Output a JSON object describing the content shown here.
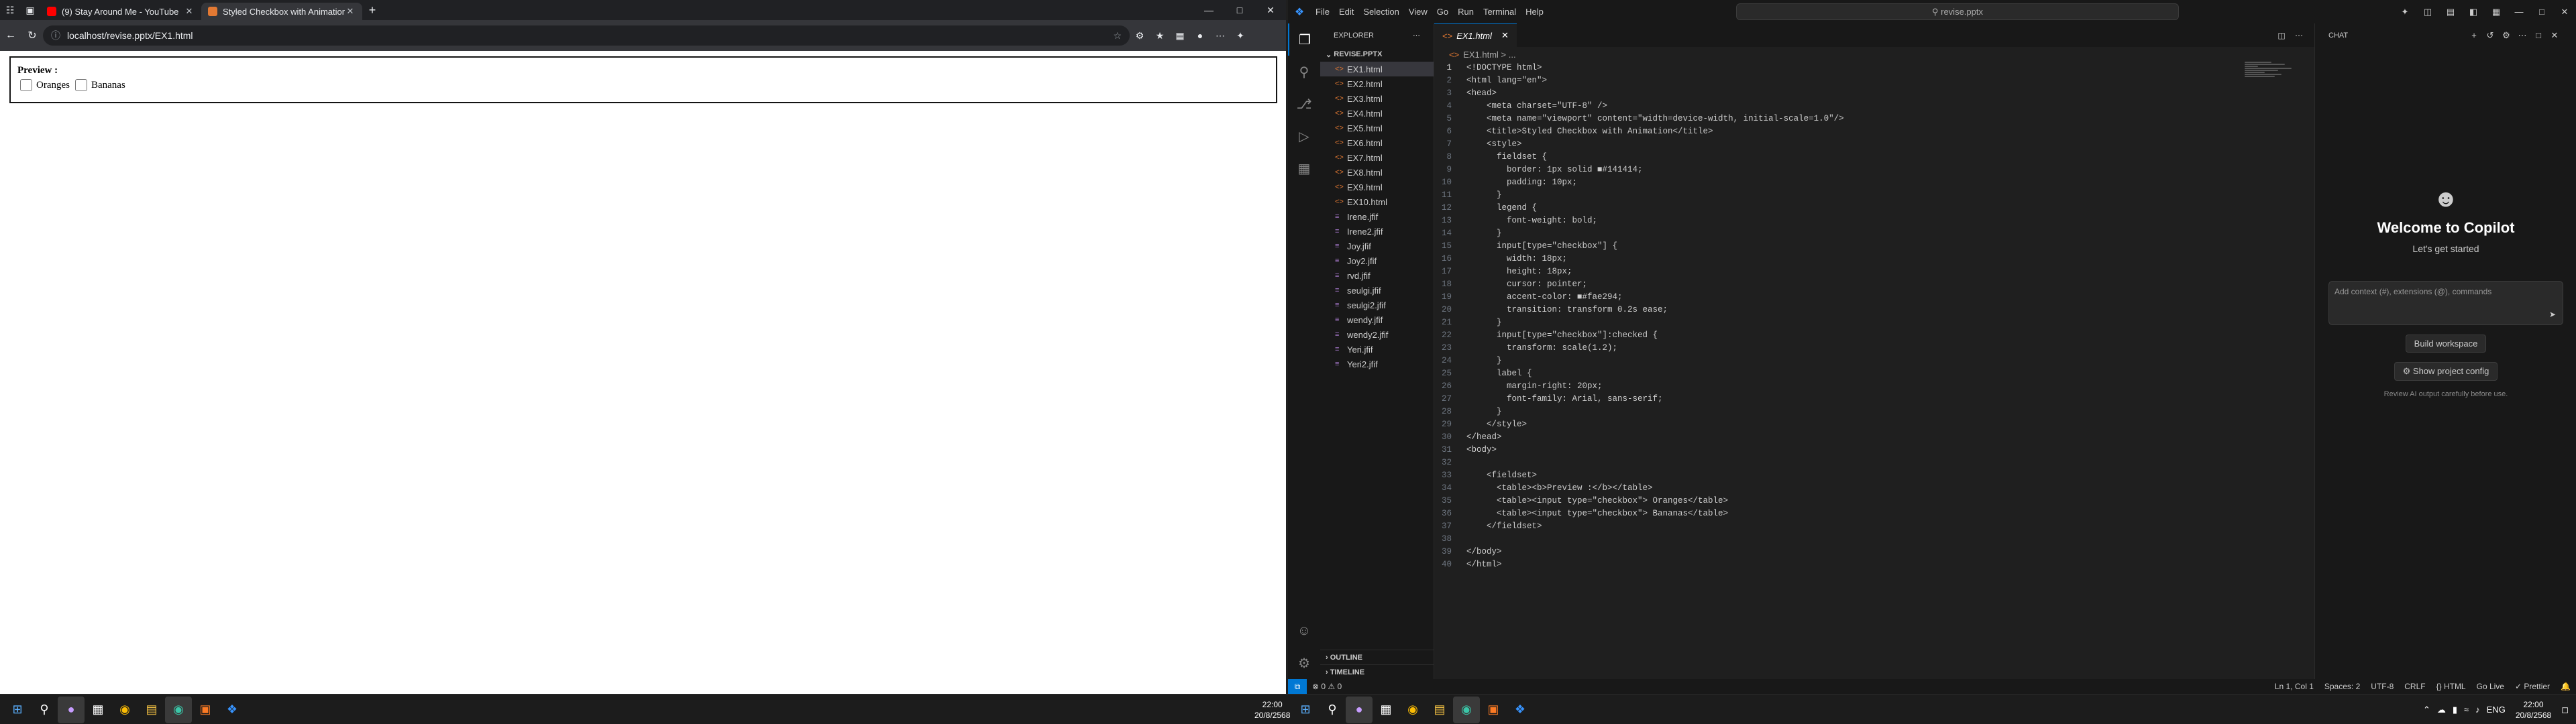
{
  "browser": {
    "tabs": [
      {
        "title": "(9) Stay Around Me - YouTube",
        "favicon_color": "#ff0000"
      },
      {
        "title": "Styled Checkbox with Animation",
        "favicon_color": "#e37933"
      }
    ],
    "url": "localhost/revise.pptx/EX1.html",
    "page": {
      "legend": "Preview :",
      "checkboxes": [
        "Oranges",
        "Bananas"
      ]
    }
  },
  "vscode": {
    "menu": [
      "File",
      "Edit",
      "Selection",
      "View",
      "Go",
      "Run",
      "Terminal",
      "Help"
    ],
    "command_center": "revise.pptx",
    "explorer_title": "EXPLORER",
    "folder": "REVISE.PPTX",
    "files": [
      {
        "name": "EX1.html",
        "icon": "<>",
        "selected": true
      },
      {
        "name": "EX2.html",
        "icon": "<>"
      },
      {
        "name": "EX3.html",
        "icon": "<>"
      },
      {
        "name": "EX4.html",
        "icon": "<>"
      },
      {
        "name": "EX5.html",
        "icon": "<>"
      },
      {
        "name": "EX6.html",
        "icon": "<>"
      },
      {
        "name": "EX7.html",
        "icon": "<>"
      },
      {
        "name": "EX8.html",
        "icon": "<>"
      },
      {
        "name": "EX9.html",
        "icon": "<>"
      },
      {
        "name": "EX10.html",
        "icon": "<>"
      },
      {
        "name": "Irene.jfif",
        "icon": "≡"
      },
      {
        "name": "Irene2.jfif",
        "icon": "≡"
      },
      {
        "name": "Joy.jfif",
        "icon": "≡"
      },
      {
        "name": "Joy2.jfif",
        "icon": "≡"
      },
      {
        "name": "rvd.jfif",
        "icon": "≡"
      },
      {
        "name": "seulgi.jfif",
        "icon": "≡"
      },
      {
        "name": "seulgi2.jfif",
        "icon": "≡"
      },
      {
        "name": "wendy.jfif",
        "icon": "≡"
      },
      {
        "name": "wendy2.jfif",
        "icon": "≡"
      },
      {
        "name": "Yeri.jfif",
        "icon": "≡"
      },
      {
        "name": "Yeri2.jfif",
        "icon": "≡"
      }
    ],
    "outline": "OUTLINE",
    "timeline": "TIMELINE",
    "editor_tab": "EX1.html",
    "breadcrumb": "EX1.html > ...",
    "code_lines": [
      "<!DOCTYPE html>",
      "<html lang=\"en\">",
      "<head>",
      "    <meta charset=\"UTF-8\" />",
      "    <meta name=\"viewport\" content=\"width=device-width, initial-scale=1.0\"/>",
      "    <title>Styled Checkbox with Animation</title>",
      "    <style>",
      "      fieldset {",
      "        border: 1px solid ■#141414;",
      "        padding: 10px;",
      "      }",
      "      legend {",
      "        font-weight: bold;",
      "      }",
      "      input[type=\"checkbox\"] {",
      "        width: 18px;",
      "        height: 18px;",
      "        cursor: pointer;",
      "        accent-color: ■#fae294;",
      "        transition: transform 0.2s ease;",
      "      }",
      "      input[type=\"checkbox\"]:checked {",
      "        transform: scale(1.2);",
      "      }",
      "      label {",
      "        margin-right: 20px;",
      "        font-family: Arial, sans-serif;",
      "      }",
      "    </style>",
      "</head>",
      "<body>",
      "",
      "    <fieldset>",
      "      <table><b>Preview :</b></table>",
      "      <table><input type=\"checkbox\"> Oranges</table>",
      "      <table><input type=\"checkbox\"> Bananas</table>",
      "    </fieldset>",
      "",
      "</body>",
      "</html>"
    ],
    "chat": {
      "title": "CHAT",
      "welcome": "Welcome to Copilot",
      "subtitle": "Let's get started",
      "input_placeholder": "Add context (#), extensions (@), commands",
      "build_workspace": "Build workspace",
      "show_config": "Show project config",
      "disclaimer": "Review AI output carefully before use."
    },
    "status": {
      "problems": "⊗ 0 ⚠ 0",
      "position": "Ln 1, Col 1",
      "spaces": "Spaces: 2",
      "encoding": "UTF-8",
      "eol": "CRLF",
      "language": "{} HTML",
      "golive": "Go Live",
      "prettier": "✓ Prettier"
    }
  },
  "taskbar": {
    "time": "22:00",
    "date": "20/8/2568",
    "lang": "ENG"
  }
}
